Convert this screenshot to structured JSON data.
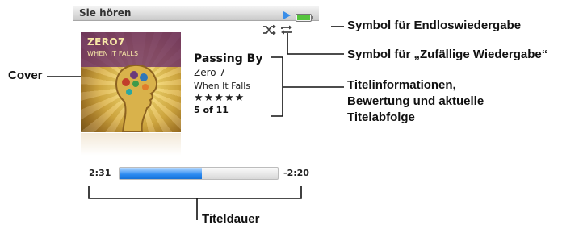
{
  "screen": {
    "title": "Sie hören",
    "status_icons": [
      "play-icon",
      "battery-icon"
    ],
    "mode_icons": [
      "shuffle-icon",
      "repeat-icon"
    ]
  },
  "now_playing": {
    "album_art": {
      "brand_text": "ZERO7",
      "small_text": "WHEN IT FALLS"
    },
    "title": "Passing By",
    "artist": "Zero 7",
    "album": "When It Falls",
    "rating_display": "★★★★★",
    "position": "5 of 11",
    "time_elapsed": "2:31",
    "time_remaining": "-2:20",
    "progress_fraction": 0.52
  },
  "callouts": {
    "cover": "Cover",
    "repeat": "Symbol für Endloswiedergabe",
    "shuffle": "Symbol für „Zufällige Wiedergabe“",
    "track_info_line1": "Titelinformationen,",
    "track_info_line2": "Bewertung und aktuelle",
    "track_info_line3": "Titelabfolge",
    "duration": "Titeldauer"
  },
  "colors": {
    "progress_fill": "#2b8af0",
    "play_icon": "#3a8ee8",
    "battery": "#55c43d"
  }
}
